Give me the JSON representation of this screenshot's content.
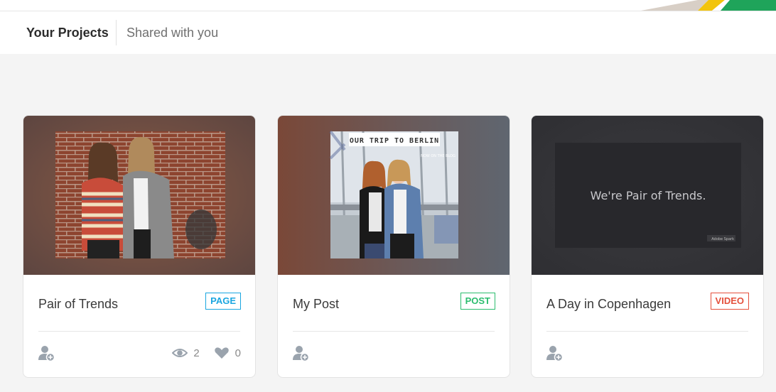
{
  "tabs": {
    "your_projects": "Your Projects",
    "shared": "Shared with you"
  },
  "cards": [
    {
      "title": "Pair of Trends",
      "badge": "PAGE",
      "badge_color": "#1aa6e0",
      "views": "2",
      "likes": "0"
    },
    {
      "title": "My Post",
      "badge": "POST",
      "badge_color": "#2bbd6e",
      "thumb_heading": "OUR TRIP TO BERLIN",
      "thumb_sub": "NOW ON THE BLOG"
    },
    {
      "title": "A Day in Copenhagen",
      "badge": "VIDEO",
      "badge_color": "#e4503c",
      "thumb_text": "We're Pair of Trends.",
      "thumb_watermark": "Adobe Spark"
    }
  ],
  "icons": {
    "collaborator": "add-collaborator-icon",
    "views": "eye-icon",
    "likes": "heart-icon"
  }
}
